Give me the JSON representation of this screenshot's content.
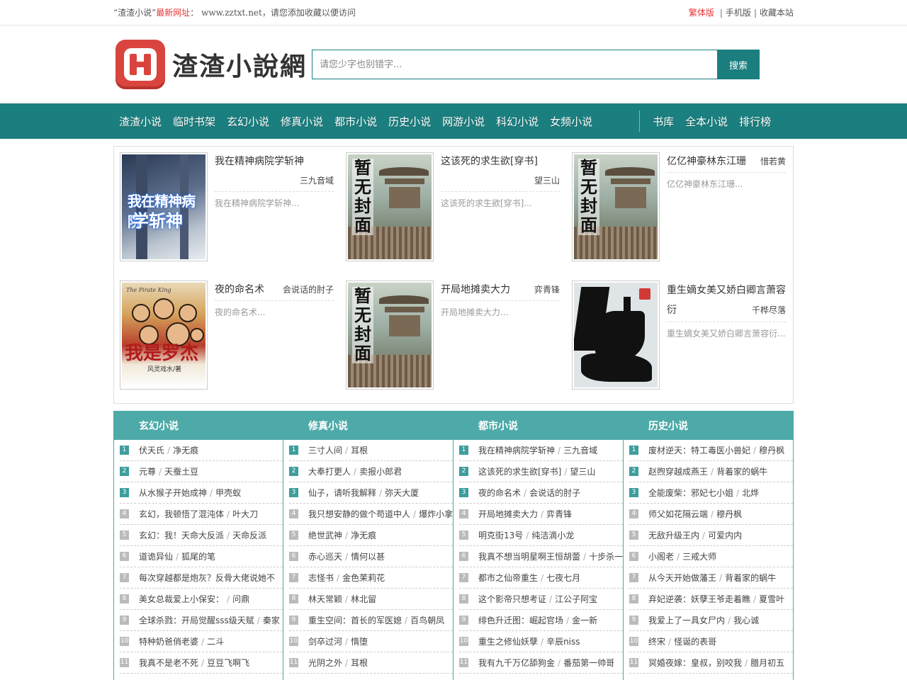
{
  "topbar": {
    "left_prefix": "“渣渣小说”",
    "left_red": "最新网址",
    "left_suffix": "： www.zztxt.net，请您添加收藏以便访问",
    "traditional": "繁体版",
    "mobile": "手机版",
    "bookmark": "收藏本站",
    "sep": "|"
  },
  "header": {
    "logo_text": "渣渣小說網",
    "search_placeholder": "请您少字也别错字...",
    "search_button": "搜索"
  },
  "nav": {
    "left": [
      "渣渣小说",
      "临时书架",
      "玄幻小说",
      "修真小说",
      "都市小说",
      "历史小说",
      "网游小说",
      "科幻小说",
      "女频小说"
    ],
    "right": [
      "书库",
      "全本小说",
      "排行榜"
    ]
  },
  "featured": [
    {
      "title": "我在精神病院学斩神",
      "author": "三九音域",
      "desc": "我在精神病院学斩神...",
      "cover": "anime",
      "cover_text": [
        "我在精神病院",
        "学斩神"
      ]
    },
    {
      "title": "这该死的求生欲[穿书]",
      "author": "望三山",
      "desc": "这该死的求生欲[穿书]...",
      "cover": "nocover",
      "cover_text": [
        "暂",
        "无",
        "封",
        "面"
      ]
    },
    {
      "title": "亿亿神豪林东江珊",
      "author": "惜若黄",
      "desc": "亿亿神豪林东江珊...",
      "cover": "nocover",
      "cover_text": [
        "暂",
        "无",
        "封",
        "面"
      ]
    },
    {
      "title": "夜的命名术",
      "author": "会说话的肘子",
      "desc": "夜的命名术...",
      "cover": "pirate",
      "cover_text": [
        "我是罗杰",
        "风灵戏水/著",
        "The Pirate King"
      ]
    },
    {
      "title": "开局地摊卖大力",
      "author": "弈青锋",
      "desc": "开局地摊卖大力...",
      "cover": "nocover",
      "cover_text": [
        "暂",
        "无",
        "封",
        "面"
      ]
    },
    {
      "title": "重生嫡女美又娇白卿言萧容衍",
      "title_line1": "重生嫡女美又娇白卿言萧容",
      "title_line2": "衍",
      "author": "千桦尽落",
      "desc": "重生嫡女美又娇白卿言萧容衍...",
      "cover": "dark",
      "cover_text": [
        "起"
      ]
    }
  ],
  "categories": [
    {
      "name": "玄幻小说",
      "items": [
        {
          "book": "伏天氏",
          "author": "净无痕"
        },
        {
          "book": "元尊",
          "author": "天蚕土豆"
        },
        {
          "book": "从水猴子开始成神",
          "author": "甲壳蚁"
        },
        {
          "book": "玄幻，我顿悟了混沌体",
          "author": "叶大刀"
        },
        {
          "book": "玄幻：我！天命大反派",
          "author": "天命反派"
        },
        {
          "book": "道诡异仙",
          "author": "狐尾的笔"
        },
        {
          "book": "每次穿越都是炮灰？反骨大佬说她不",
          "author": ""
        },
        {
          "book": "美女总裁爱上小保安：",
          "author": "问鼎"
        },
        {
          "book": "全球杀戮：开局觉醒sss级天赋",
          "author": "秦家"
        },
        {
          "book": "特种奶爸俏老婆",
          "author": "二斗"
        },
        {
          "book": "我真不是老不死",
          "author": "豆豆飞啊飞"
        }
      ]
    },
    {
      "name": "修真小说",
      "items": [
        {
          "book": "三寸人间",
          "author": "耳根"
        },
        {
          "book": "大奉打更人",
          "author": "卖报小郎君"
        },
        {
          "book": "仙子，请听我解释",
          "author": "弥天大厦"
        },
        {
          "book": "我只想安静的做个苟道中人",
          "author": "爆炸小拿"
        },
        {
          "book": "绝世武神",
          "author": "净无痕"
        },
        {
          "book": "赤心巡天",
          "author": "情何以甚"
        },
        {
          "book": "志怪书",
          "author": "金色茉莉花"
        },
        {
          "book": "林天常颖",
          "author": "林北留"
        },
        {
          "book": "重生空间：首长的军医媳",
          "author": "百鸟朝凤"
        },
        {
          "book": "剑卒过河",
          "author": "惰堕"
        },
        {
          "book": "光阴之外",
          "author": "耳根"
        }
      ]
    },
    {
      "name": "都市小说",
      "items": [
        {
          "book": "我在精神病院学斩神",
          "author": "三九音域"
        },
        {
          "book": "这该死的求生欲[穿书]",
          "author": "望三山"
        },
        {
          "book": "夜的命名术",
          "author": "会说话的肘子"
        },
        {
          "book": "开局地摊卖大力",
          "author": "弈青锋"
        },
        {
          "book": "明克街13号",
          "author": "纯洁滴小龙"
        },
        {
          "book": "我真不想当明星啊王恒胡蕾",
          "author": "十步杀一"
        },
        {
          "book": "都市之仙帝重生",
          "author": "七夜七月"
        },
        {
          "book": "这个影帝只想考证",
          "author": "江公子阿宝"
        },
        {
          "book": "绯色升迁图：崛起官场",
          "author": "金一新"
        },
        {
          "book": "重生之修仙妖孽",
          "author": "辛辰niss"
        },
        {
          "book": "我有九千万亿舔狗金",
          "author": "番茄第一帅哥"
        }
      ]
    },
    {
      "name": "历史小说",
      "items": [
        {
          "book": "废材逆天：特工毒医小兽妃",
          "author": "穆丹枫"
        },
        {
          "book": "赵煦穿越成燕王",
          "author": "背着家的蜗牛"
        },
        {
          "book": "全能废柴：邪妃七小姐",
          "author": "北烨"
        },
        {
          "book": "师父如花隔云端",
          "author": "穆丹枫"
        },
        {
          "book": "无敌升级王内",
          "author": "可爱内内"
        },
        {
          "book": "小阁老",
          "author": "三戒大师"
        },
        {
          "book": "从今天开始做藩王",
          "author": "背着家的蜗牛"
        },
        {
          "book": "弃妃逆袭：妖孽王爷走着瞧",
          "author": "夏雪叶"
        },
        {
          "book": "我爱上了一具女尸内",
          "author": "我心诚"
        },
        {
          "book": "终宋",
          "author": "怪诞的表哥"
        },
        {
          "book": "冥婚夜嫁：皇叔，别咬我",
          "author": "腊月初五"
        }
      ]
    }
  ]
}
